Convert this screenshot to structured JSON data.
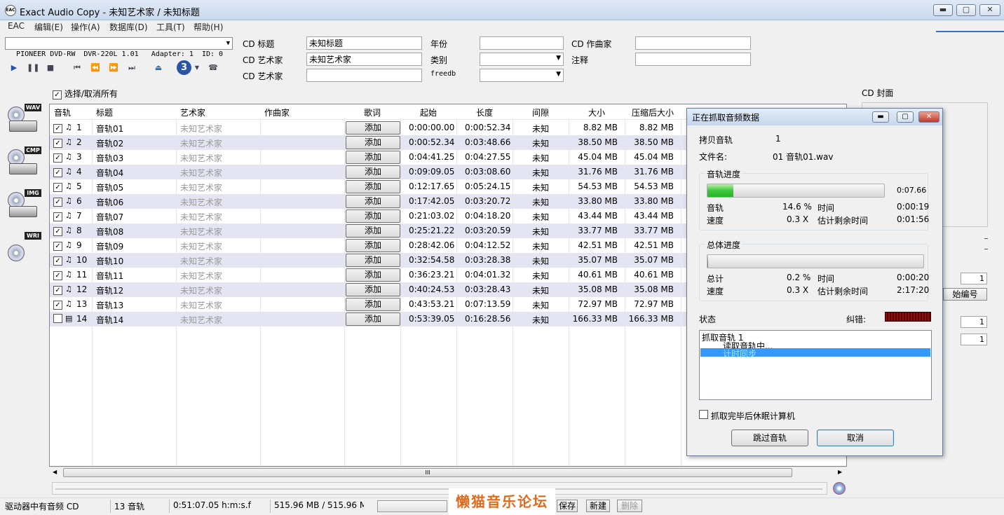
{
  "window": {
    "title": "Exact Audio Copy   -   未知艺术家 / 未知标题",
    "icon_text": "EAC"
  },
  "menu": [
    "EAC",
    "编辑(E)",
    "操作(A)",
    "数据库(D)",
    "工具(T)",
    "帮助(H)"
  ],
  "drive": {
    "value": "PIONEER DVD-RW  DVR-220L 1.01   Adapter: 1  ID: 0"
  },
  "toolbar": {
    "track_number": "3",
    "icons": [
      "play-icon",
      "pause-icon",
      "stop-icon",
      "first-track-icon",
      "prev-track-icon",
      "next-track-icon",
      "last-track-icon",
      "eject-icon",
      "track-count-icon",
      "dropdown-icon",
      "drive-settings-icon"
    ]
  },
  "cd_info": {
    "title_label": "CD 标题",
    "title_value": "未知标题",
    "artist_label": "CD 艺术家",
    "artist_value": "未知艺术家",
    "artist2_label": "CD 艺术家",
    "artist2_value": "",
    "year_label": "年份",
    "year_value": "",
    "genre_label": "类别",
    "genre_value": "",
    "freedb_label": "freedb",
    "freedb_value": "",
    "composer_label": "CD 作曲家",
    "composer_value": "",
    "comment_label": "注释",
    "comment_value": ""
  },
  "select_all_label": "选择/取消所有",
  "side_tags": [
    "WAV",
    "CMP",
    "IMG",
    "WRI"
  ],
  "table": {
    "headers": [
      "音轨",
      "标题",
      "艺术家",
      "作曲家",
      "歌词",
      "起始",
      "长度",
      "间隙",
      "大小",
      "压缩后大小"
    ],
    "add_label": "添加",
    "rows": [
      {
        "num": "1",
        "checked": true,
        "title": "音轨01",
        "artist": "未知艺术家",
        "start": "0:00:00.00",
        "length": "0:00:52.34",
        "gap": "未知",
        "size": "8.82 MB",
        "csize": "8.82 MB"
      },
      {
        "num": "2",
        "checked": true,
        "title": "音轨02",
        "artist": "未知艺术家",
        "start": "0:00:52.34",
        "length": "0:03:48.66",
        "gap": "未知",
        "size": "38.50 MB",
        "csize": "38.50 MB"
      },
      {
        "num": "3",
        "checked": true,
        "title": "音轨03",
        "artist": "未知艺术家",
        "start": "0:04:41.25",
        "length": "0:04:27.55",
        "gap": "未知",
        "size": "45.04 MB",
        "csize": "45.04 MB"
      },
      {
        "num": "4",
        "checked": true,
        "title": "音轨04",
        "artist": "未知艺术家",
        "start": "0:09:09.05",
        "length": "0:03:08.60",
        "gap": "未知",
        "size": "31.76 MB",
        "csize": "31.76 MB"
      },
      {
        "num": "5",
        "checked": true,
        "title": "音轨05",
        "artist": "未知艺术家",
        "start": "0:12:17.65",
        "length": "0:05:24.15",
        "gap": "未知",
        "size": "54.53 MB",
        "csize": "54.53 MB"
      },
      {
        "num": "6",
        "checked": true,
        "title": "音轨06",
        "artist": "未知艺术家",
        "start": "0:17:42.05",
        "length": "0:03:20.72",
        "gap": "未知",
        "size": "33.80 MB",
        "csize": "33.80 MB"
      },
      {
        "num": "7",
        "checked": true,
        "title": "音轨07",
        "artist": "未知艺术家",
        "start": "0:21:03.02",
        "length": "0:04:18.20",
        "gap": "未知",
        "size": "43.44 MB",
        "csize": "43.44 MB"
      },
      {
        "num": "8",
        "checked": true,
        "title": "音轨08",
        "artist": "未知艺术家",
        "start": "0:25:21.22",
        "length": "0:03:20.59",
        "gap": "未知",
        "size": "33.77 MB",
        "csize": "33.77 MB"
      },
      {
        "num": "9",
        "checked": true,
        "title": "音轨09",
        "artist": "未知艺术家",
        "start": "0:28:42.06",
        "length": "0:04:12.52",
        "gap": "未知",
        "size": "42.51 MB",
        "csize": "42.51 MB"
      },
      {
        "num": "10",
        "checked": true,
        "title": "音轨10",
        "artist": "未知艺术家",
        "start": "0:32:54.58",
        "length": "0:03:28.38",
        "gap": "未知",
        "size": "35.07 MB",
        "csize": "35.07 MB"
      },
      {
        "num": "11",
        "checked": true,
        "title": "音轨11",
        "artist": "未知艺术家",
        "start": "0:36:23.21",
        "length": "0:04:01.32",
        "gap": "未知",
        "size": "40.61 MB",
        "csize": "40.61 MB"
      },
      {
        "num": "12",
        "checked": true,
        "title": "音轨12",
        "artist": "未知艺术家",
        "start": "0:40:24.53",
        "length": "0:03:28.43",
        "gap": "未知",
        "size": "35.08 MB",
        "csize": "35.08 MB"
      },
      {
        "num": "13",
        "checked": true,
        "title": "音轨13",
        "artist": "未知艺术家",
        "start": "0:43:53.21",
        "length": "0:07:13.59",
        "gap": "未知",
        "size": "72.97 MB",
        "csize": "72.97 MB"
      },
      {
        "num": "14",
        "checked": false,
        "title": "音轨14",
        "artist": "未知艺术家",
        "start": "0:53:39.05",
        "length": "0:16:28.56",
        "gap": "未知",
        "size": "166.33 MB",
        "csize": "166.33 MB"
      }
    ]
  },
  "scroll_grip": "III",
  "statusbar": {
    "disc_status": "驱动器中有音频 CD",
    "track_count": "13 音轨",
    "total_time": "0:51:07.05 h:m:s.f",
    "total_size": "515.96 MB / 515.96 M",
    "save": "保存",
    "new": "新建",
    "delete": "删除"
  },
  "watermark": "懒猫音乐论坛",
  "right_panel": {
    "cover_label": "CD 封面",
    "numbering_button": "始编号",
    "num1": "1",
    "num2": "1",
    "num3": "1"
  },
  "dialog": {
    "title": "正在抓取音频数据",
    "copy_track_label": "拷贝音轨",
    "copy_track_value": "1",
    "filename_label": "文件名:",
    "filename_value": "01 音轨01.wav",
    "track_progress": {
      "group_label": "音轨进度",
      "percent": 14.6,
      "time_shown": "0:07.66",
      "track_label": "音轨",
      "track_pct": "14.6 %",
      "time_label": "时间",
      "time_value": "0:00:19",
      "speed_label": "速度",
      "speed_value": "0.3 X",
      "remaining_label": "估计剩余时间",
      "remaining_value": "0:01:56"
    },
    "total_progress": {
      "group_label": "总体进度",
      "percent": 0.2,
      "total_label": "总计",
      "total_pct": "0.2 %",
      "time_label": "时间",
      "time_value": "0:00:20",
      "speed_label": "速度",
      "speed_value": "0.3 X",
      "remaining_label": "估计剩余时间",
      "remaining_value": "2:17:20"
    },
    "status_label": "状态",
    "error_label": "纠错:",
    "status_lines": [
      "抓取音轨  1",
      "读取音轨中...",
      "计时同步"
    ],
    "sleep_label": "抓取完毕后休眠计算机",
    "skip_button": "跳过音轨",
    "cancel_button": "取消"
  },
  "colors": {
    "accent": "#3399ff",
    "progress_green": "#3cc83c",
    "alt_row": "#e4e4f2"
  }
}
